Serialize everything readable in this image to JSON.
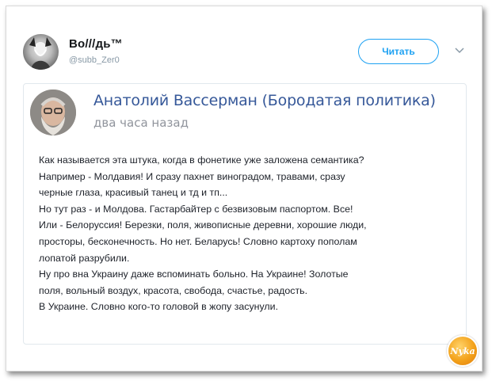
{
  "tweet": {
    "author_name": "Во///дь™",
    "author_handle": "@subb_Zer0",
    "follow_label": "Читать"
  },
  "quoted_post": {
    "author_name": "Анатолий Вассерман (Бородатая политика)",
    "time": "два часа назад",
    "lines": [
      "Как называется эта штука, когда в фонетике уже заложена семантика?",
      "Например - Молдавия! И сразу пахнет виноградом, травами, сразу",
      "черные глаза, красивый танец и тд и тп...",
      "Но тут раз - и Молдова. Гастарбайтер с безвизовым паспортом. Все!",
      "Или - Белоруссия! Березки, поля, живописные деревни, хорошие люди,",
      "просторы, бесконечность. Но нет. Беларусь! Словно картоху пополам",
      "лопатой разрубили.",
      "Ну про вна Украину даже вспоминать больно. На Украине! Золотые",
      "поля, вольный воздух, красота, свобода, счастье, радость.",
      "В Украине. Словно кого-то головой в жопу засунули."
    ]
  },
  "watermark": {
    "text": "Nyka"
  },
  "icons": {
    "avatar": "avatar-icon",
    "chevron": "chevron-down-icon",
    "watermark": "watermark-logo"
  },
  "colors": {
    "accent": "#1da1f2",
    "quote_name": "#365899",
    "muted": "#8899a6"
  }
}
